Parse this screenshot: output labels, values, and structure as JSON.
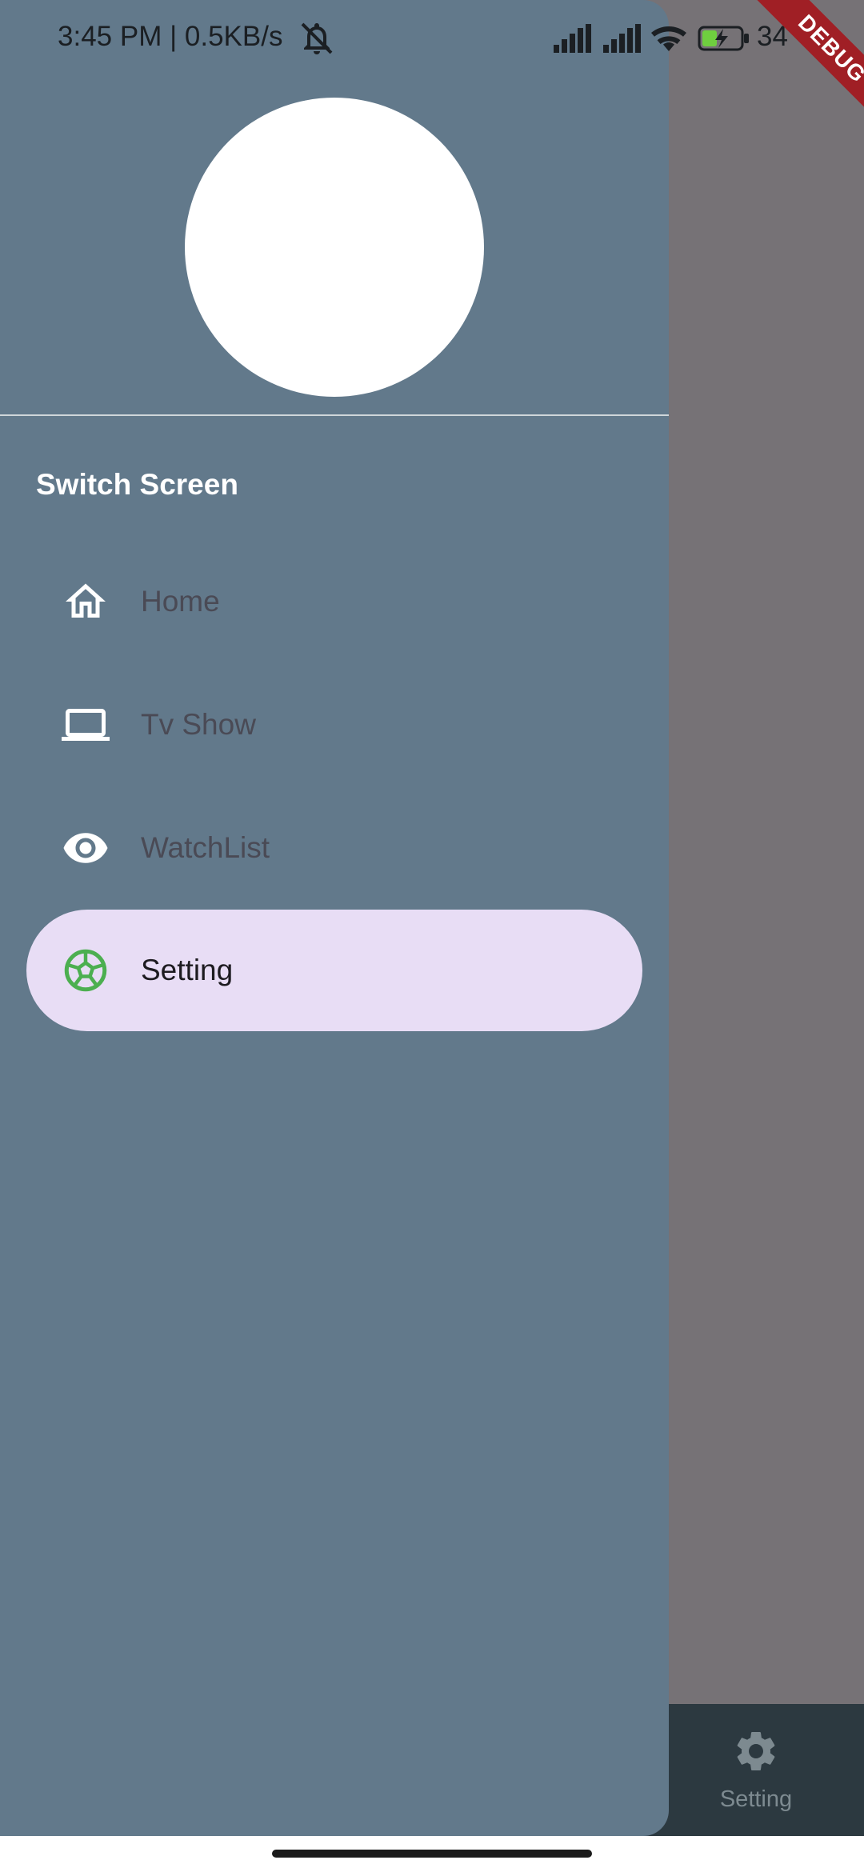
{
  "status_bar": {
    "time_speed": "3:45 PM | 0.5KB/s",
    "battery_percent": "34",
    "icons": [
      "mute-icon",
      "signal-icon",
      "signal-icon",
      "wifi-icon",
      "battery-charging-icon"
    ]
  },
  "debug_banner": {
    "label": "DEBUG"
  },
  "drawer": {
    "section_title": "Switch Screen",
    "items": [
      {
        "label": "Home",
        "icon": "home-icon",
        "selected": false
      },
      {
        "label": "Tv Show",
        "icon": "laptop-icon",
        "selected": false
      },
      {
        "label": "WatchList",
        "icon": "eye-icon",
        "selected": false
      },
      {
        "label": "Setting",
        "icon": "soccer-ball-icon",
        "selected": true
      }
    ]
  },
  "bottom_nav": {
    "items": [
      {
        "label": "Setting",
        "icon": "gear-icon"
      }
    ]
  },
  "colors": {
    "drawer_bg": "#62798b",
    "selected_item_bg": "#e8ddf5",
    "scrim": "#767276",
    "bottom_nav_bg": "#2c3940",
    "ball_icon": "#4caf50",
    "debug_banner": "#a01f25"
  }
}
